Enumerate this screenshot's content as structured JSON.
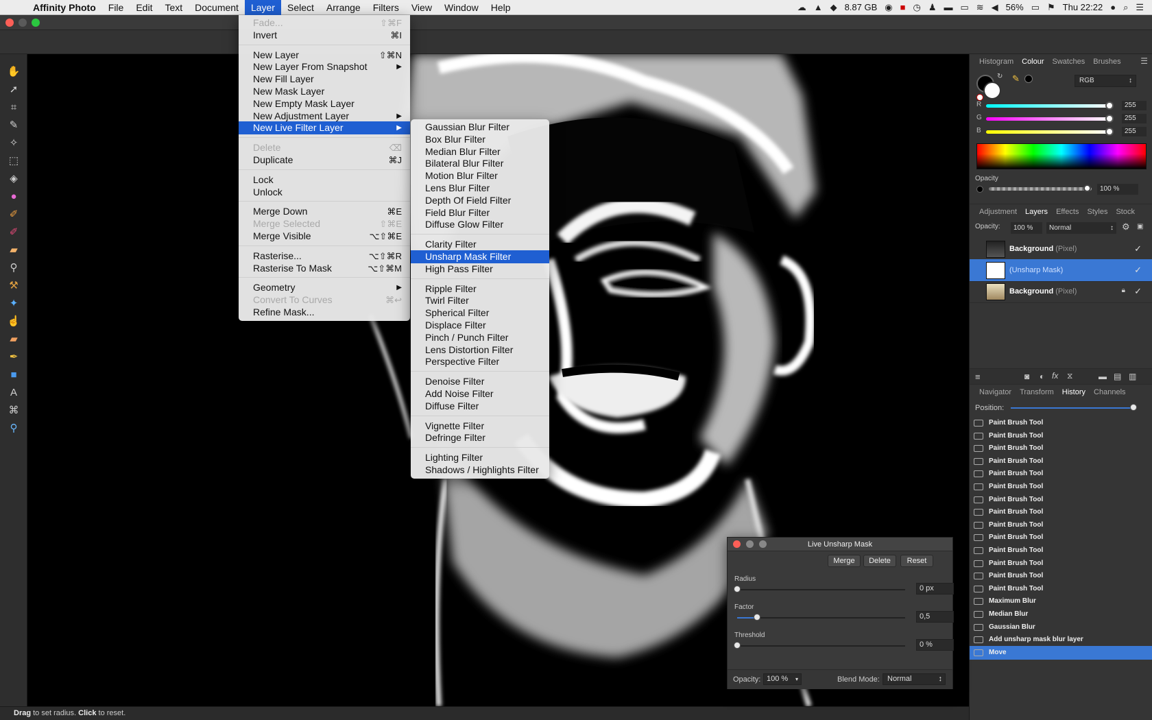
{
  "menubar": {
    "app": "Affinity Photo",
    "items": [
      "File",
      "Edit",
      "Text",
      "Document",
      "Layer",
      "Select",
      "Arrange",
      "Filters",
      "View",
      "Window",
      "Help"
    ],
    "active": "Layer",
    "disk": "8.87 GB",
    "battery": "56%",
    "clock": "Thu 22:22"
  },
  "layer_menu": [
    {
      "label": "Fade...",
      "shortcut": "⇧⌘F",
      "disabled": true
    },
    {
      "label": "Invert",
      "shortcut": "⌘I"
    },
    {
      "sep": true
    },
    {
      "label": "New Layer",
      "shortcut": "⇧⌘N"
    },
    {
      "label": "New Layer From Snapshot",
      "submenu": true
    },
    {
      "label": "New Fill Layer"
    },
    {
      "label": "New Mask Layer"
    },
    {
      "label": "New Empty Mask Layer"
    },
    {
      "label": "New Adjustment Layer",
      "submenu": true
    },
    {
      "label": "New Live Filter Layer",
      "submenu": true,
      "highlighted": true
    },
    {
      "sep": true
    },
    {
      "label": "Delete",
      "shortcut": "⌫",
      "disabled": true
    },
    {
      "label": "Duplicate",
      "shortcut": "⌘J"
    },
    {
      "sep": true
    },
    {
      "label": "Lock"
    },
    {
      "label": "Unlock"
    },
    {
      "sep": true
    },
    {
      "label": "Merge Down",
      "shortcut": "⌘E"
    },
    {
      "label": "Merge Selected",
      "shortcut": "⇧⌘E",
      "disabled": true
    },
    {
      "label": "Merge Visible",
      "shortcut": "⌥⇧⌘E"
    },
    {
      "sep": true
    },
    {
      "label": "Rasterise...",
      "shortcut": "⌥⇧⌘R"
    },
    {
      "label": "Rasterise To Mask",
      "shortcut": "⌥⇧⌘M"
    },
    {
      "sep": true
    },
    {
      "label": "Geometry",
      "submenu": true
    },
    {
      "label": "Convert To Curves",
      "shortcut": "⌘↩",
      "disabled": true
    },
    {
      "label": "Refine Mask..."
    }
  ],
  "filter_menu": [
    {
      "label": "Gaussian Blur Filter"
    },
    {
      "label": "Box Blur Filter"
    },
    {
      "label": "Median Blur Filter"
    },
    {
      "label": "Bilateral Blur Filter"
    },
    {
      "label": "Motion Blur Filter"
    },
    {
      "label": "Lens Blur Filter"
    },
    {
      "label": "Depth Of Field Filter"
    },
    {
      "label": "Field Blur Filter"
    },
    {
      "label": "Diffuse Glow Filter"
    },
    {
      "sep": true
    },
    {
      "label": "Clarity Filter"
    },
    {
      "label": "Unsharp Mask Filter",
      "highlighted": true
    },
    {
      "label": "High Pass Filter"
    },
    {
      "sep": true
    },
    {
      "label": "Ripple Filter"
    },
    {
      "label": "Twirl Filter"
    },
    {
      "label": "Spherical Filter"
    },
    {
      "label": "Displace Filter"
    },
    {
      "label": "Pinch / Punch Filter"
    },
    {
      "label": "Lens Distortion Filter"
    },
    {
      "label": "Perspective Filter"
    },
    {
      "sep": true
    },
    {
      "label": "Denoise Filter"
    },
    {
      "label": "Add Noise Filter"
    },
    {
      "label": "Diffuse Filter"
    },
    {
      "sep": true
    },
    {
      "label": "Vignette Filter"
    },
    {
      "label": "Defringe Filter"
    },
    {
      "sep": true
    },
    {
      "label": "Lighting Filter"
    },
    {
      "label": "Shadows / Highlights Filter"
    }
  ],
  "colour_panel": {
    "tabs": [
      "Histogram",
      "Colour",
      "Swatches",
      "Brushes"
    ],
    "active": "Colour",
    "mode": "RGB",
    "channels": [
      {
        "label": "R",
        "value": "255"
      },
      {
        "label": "G",
        "value": "255"
      },
      {
        "label": "B",
        "value": "255"
      }
    ],
    "opacity_label": "Opacity",
    "opacity": "100 %"
  },
  "layers_panel": {
    "tabs": [
      "Adjustment",
      "Layers",
      "Effects",
      "Styles",
      "Stock"
    ],
    "active": "Layers",
    "opacity_label": "Opacity:",
    "opacity": "100 %",
    "blend": "Normal",
    "layers": [
      {
        "name": "Background",
        "type": "(Pixel)",
        "selected": false,
        "locked": false
      },
      {
        "name": "",
        "type": "(Unsharp Mask)",
        "selected": true,
        "locked": false
      },
      {
        "name": "Background",
        "type": "(Pixel)",
        "selected": false,
        "locked": true
      }
    ]
  },
  "history_panel": {
    "tabs": [
      "Navigator",
      "Transform",
      "History",
      "Channels"
    ],
    "active": "History",
    "position_label": "Position:",
    "items": [
      "Paint Brush Tool",
      "Paint Brush Tool",
      "Paint Brush Tool",
      "Paint Brush Tool",
      "Paint Brush Tool",
      "Paint Brush Tool",
      "Paint Brush Tool",
      "Paint Brush Tool",
      "Paint Brush Tool",
      "Paint Brush Tool",
      "Paint Brush Tool",
      "Paint Brush Tool",
      "Paint Brush Tool",
      "Paint Brush Tool",
      "Maximum Blur",
      "Median Blur",
      "Gaussian Blur",
      "Add unsharp mask blur layer",
      "Move"
    ],
    "selected_index": 18
  },
  "dialog": {
    "title": "Live Unsharp Mask",
    "buttons": [
      "Merge",
      "Delete",
      "Reset"
    ],
    "sliders": [
      {
        "label": "Radius",
        "value": "0 px",
        "fraction": 0.0
      },
      {
        "label": "Factor",
        "value": "0,5",
        "fraction": 0.12
      },
      {
        "label": "Threshold",
        "value": "0 %",
        "fraction": 0.0
      }
    ],
    "opacity_label": "Opacity:",
    "opacity": "100 %",
    "blend_label": "Blend Mode:",
    "blend": "Normal"
  },
  "status": {
    "bold1": "Drag",
    "text1": " to set radius. ",
    "bold2": "Click",
    "text2": " to reset."
  }
}
